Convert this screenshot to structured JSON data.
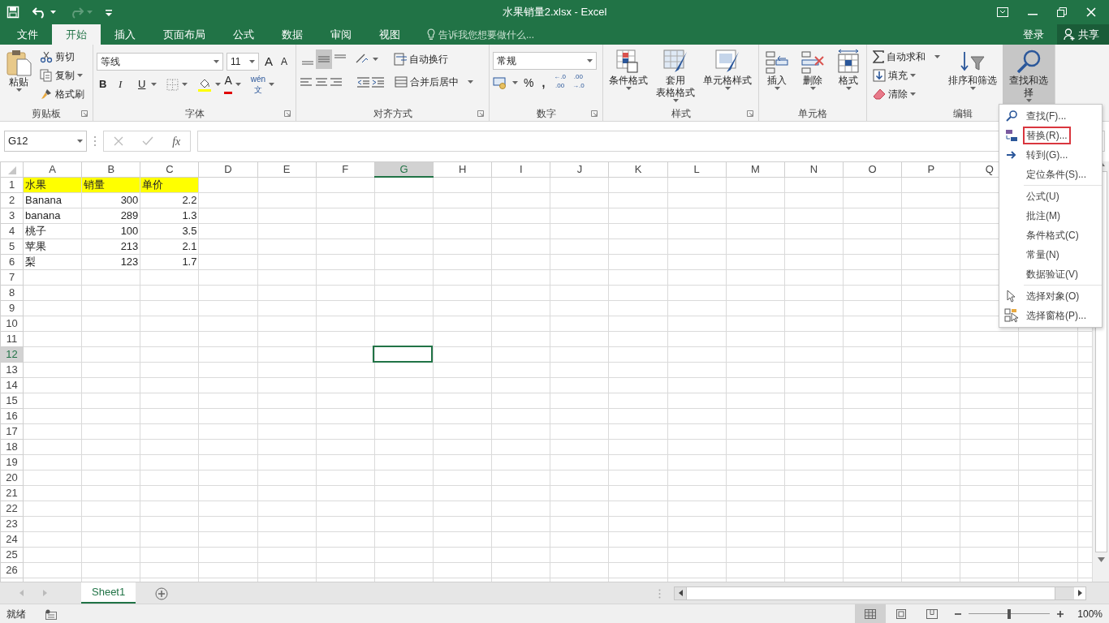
{
  "title_bar": {
    "title": "水果销量2.xlsx - Excel"
  },
  "tabs": [
    {
      "label": "文件",
      "selected": false
    },
    {
      "label": "开始",
      "selected": true
    },
    {
      "label": "插入",
      "selected": false
    },
    {
      "label": "页面布局",
      "selected": false
    },
    {
      "label": "公式",
      "selected": false
    },
    {
      "label": "数据",
      "selected": false
    },
    {
      "label": "审阅",
      "selected": false
    },
    {
      "label": "视图",
      "selected": false
    }
  ],
  "tell_me": {
    "placeholder": "告诉我您想要做什么..."
  },
  "account": {
    "sign_in": "登录",
    "share": "共享"
  },
  "ribbon": {
    "clipboard": {
      "label": "剪贴板",
      "paste": "粘贴",
      "cut": "剪切",
      "copy": "复制",
      "format_painter": "格式刷"
    },
    "font": {
      "label": "字体",
      "font_name": "等线",
      "font_size": "11",
      "grow": "A",
      "shrink": "A",
      "bold": "B",
      "italic": "I",
      "underline": "U",
      "font_color": "A",
      "phonetic_top": "wén",
      "phonetic_bottom": "文"
    },
    "alignment": {
      "label": "对齐方式",
      "vertical": [
        {
          "selected": false
        },
        {
          "selected": true
        },
        {
          "selected": false
        }
      ],
      "wrap": "自动换行",
      "merge": "合并后居中"
    },
    "number": {
      "label": "数字",
      "format": "常规",
      "percent": "%",
      "comma": ",",
      "more_decimals": [
        "←.0",
        ".00"
      ],
      "fewer_decimals": [
        ".00",
        "→.0"
      ]
    },
    "styles": {
      "label": "样式",
      "buttons": [
        {
          "lines": [
            "条件格式"
          ]
        },
        {
          "lines": [
            "套用",
            "表格格式"
          ]
        },
        {
          "lines": [
            "单元格样式"
          ]
        }
      ]
    },
    "cells": {
      "label": "单元格",
      "buttons": [
        "插入",
        "删除",
        "格式"
      ]
    },
    "editing": {
      "label": "编辑",
      "autosum": "自动求和",
      "fill": "填充",
      "clear": "清除",
      "sort": "排序和筛选",
      "find": "查找和选择",
      "find_pressed": true
    }
  },
  "formula_bar": {
    "name_box": "G12",
    "function_label": "fx"
  },
  "columns": [
    {
      "label": "A",
      "selected": false
    },
    {
      "label": "B",
      "selected": false
    },
    {
      "label": "C",
      "selected": false
    },
    {
      "label": "D",
      "selected": false
    },
    {
      "label": "E",
      "selected": false
    },
    {
      "label": "F",
      "selected": false
    },
    {
      "label": "G",
      "selected": true
    },
    {
      "label": "H",
      "selected": false
    },
    {
      "label": "I",
      "selected": false
    },
    {
      "label": "J",
      "selected": false
    },
    {
      "label": "K",
      "selected": false
    },
    {
      "label": "L",
      "selected": false
    },
    {
      "label": "M",
      "selected": false
    },
    {
      "label": "N",
      "selected": false
    },
    {
      "label": "O",
      "selected": false
    },
    {
      "label": "P",
      "selected": false
    },
    {
      "label": "Q",
      "selected": false
    }
  ],
  "rows": [
    {
      "number": "1",
      "selected": false,
      "cells": [
        {
          "text": "水果",
          "kind": "text",
          "filled": true
        },
        {
          "text": "销量",
          "kind": "text",
          "filled": true
        },
        {
          "text": "单价",
          "kind": "text",
          "filled": true
        }
      ]
    },
    {
      "number": "2",
      "selected": false,
      "cells": [
        {
          "text": "Banana",
          "kind": "text",
          "filled": false
        },
        {
          "text": "300",
          "kind": "number",
          "filled": false
        },
        {
          "text": "2.2",
          "kind": "number",
          "filled": false
        }
      ]
    },
    {
      "number": "3",
      "selected": false,
      "cells": [
        {
          "text": "banana",
          "kind": "text",
          "filled": false
        },
        {
          "text": "289",
          "kind": "number",
          "filled": false
        },
        {
          "text": "1.3",
          "kind": "number",
          "filled": false
        }
      ]
    },
    {
      "number": "4",
      "selected": false,
      "cells": [
        {
          "text": "桃子",
          "kind": "text",
          "filled": false
        },
        {
          "text": "100",
          "kind": "number",
          "filled": false
        },
        {
          "text": "3.5",
          "kind": "number",
          "filled": false
        }
      ]
    },
    {
      "number": "5",
      "selected": false,
      "cells": [
        {
          "text": "苹果",
          "kind": "text",
          "filled": false
        },
        {
          "text": "213",
          "kind": "number",
          "filled": false
        },
        {
          "text": "2.1",
          "kind": "number",
          "filled": false
        }
      ]
    },
    {
      "number": "6",
      "selected": false,
      "cells": [
        {
          "text": "梨",
          "kind": "text",
          "filled": false
        },
        {
          "text": "123",
          "kind": "number",
          "filled": false
        },
        {
          "text": "1.7",
          "kind": "number",
          "filled": false
        }
      ]
    },
    {
      "number": "7",
      "selected": false
    },
    {
      "number": "8",
      "selected": false
    },
    {
      "number": "9",
      "selected": false
    },
    {
      "number": "10",
      "selected": false
    },
    {
      "number": "11",
      "selected": false
    },
    {
      "number": "12",
      "selected": true
    },
    {
      "number": "13",
      "selected": false
    },
    {
      "number": "14",
      "selected": false
    },
    {
      "number": "15",
      "selected": false
    },
    {
      "number": "16",
      "selected": false
    },
    {
      "number": "17",
      "selected": false
    },
    {
      "number": "18",
      "selected": false
    },
    {
      "number": "19",
      "selected": false
    },
    {
      "number": "20",
      "selected": false
    },
    {
      "number": "21",
      "selected": false
    },
    {
      "number": "22",
      "selected": false
    },
    {
      "number": "23",
      "selected": false
    },
    {
      "number": "24",
      "selected": false
    },
    {
      "number": "25",
      "selected": false
    },
    {
      "number": "26",
      "selected": false
    }
  ],
  "find_menu": {
    "sections": [
      {
        "items": [
          {
            "label": "查找(F)...",
            "outlined": false
          },
          {
            "label": "替换(R)...",
            "outlined": true
          },
          {
            "label": "转到(G)...",
            "outlined": false
          },
          {
            "label": "定位条件(S)...",
            "outlined": false
          }
        ]
      },
      {
        "items": [
          {
            "label": "公式(U)",
            "outlined": false
          },
          {
            "label": "批注(M)",
            "outlined": false
          },
          {
            "label": "条件格式(C)",
            "outlined": false
          },
          {
            "label": "常量(N)",
            "outlined": false
          },
          {
            "label": "数据验证(V)",
            "outlined": false
          }
        ]
      },
      {
        "items": [
          {
            "label": "选择对象(O)",
            "outlined": false
          },
          {
            "label": "选择窗格(P)...",
            "outlined": false
          }
        ]
      }
    ]
  },
  "sheets": [
    {
      "label": "Sheet1",
      "selected": true
    }
  ],
  "status_bar": {
    "status": "就绪",
    "views": [
      {
        "selected": true
      },
      {
        "selected": false
      },
      {
        "selected": false
      }
    ],
    "zoom": {
      "level": 0.5
    },
    "zoom_text": "100%"
  }
}
